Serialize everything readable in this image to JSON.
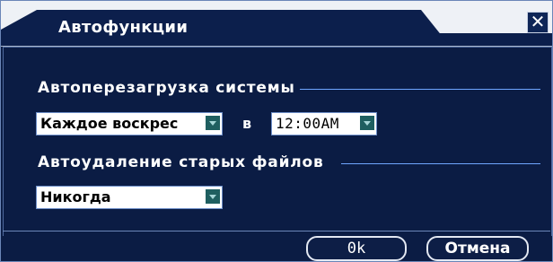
{
  "window": {
    "title": "Автофункции",
    "close_glyph": "✕"
  },
  "auto_reboot": {
    "label": "Автоперезагрузка системы",
    "day_value": "Каждое воскрес",
    "in_label": "в",
    "time_value": "12:00AM"
  },
  "auto_delete": {
    "label": "Автоудаление старых файлов",
    "value": "Никогда"
  },
  "buttons": {
    "ok_label": "0k",
    "cancel_label": "Отмена"
  },
  "icons": {
    "close": "close-icon",
    "dropdown": "chevron-down-icon"
  },
  "colors": {
    "background": "#0b1c44",
    "accent_line": "#6fa6ff",
    "titlebar": "#eef1f6",
    "dropdown_arrow": "#1f5f60"
  }
}
